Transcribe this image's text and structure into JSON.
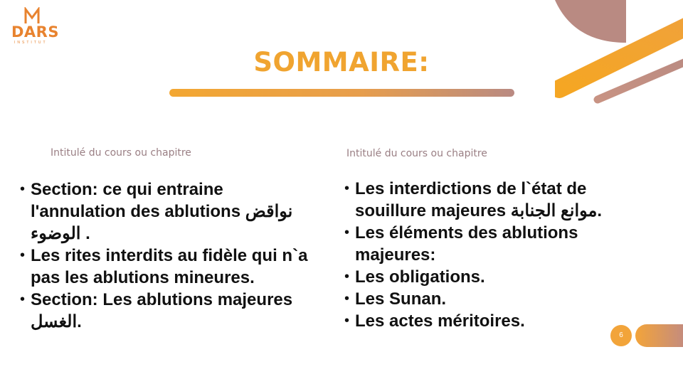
{
  "logo": {
    "name": "DARS",
    "subtitle": "INSTITUT"
  },
  "title": "SOMMAIRE:",
  "left_column": {
    "heading": "Intitulé du cours ou chapitre",
    "items": [
      "Section: ce qui entraine l'annulation des ablutions نواقض الوضوء .",
      "Les rites interdits au fidèle qui n`a pas les ablutions mineures.",
      "Section: Les ablutions majeures الغسل."
    ]
  },
  "right_column": {
    "heading": "Intitulé du cours ou chapitre",
    "items": [
      "Les interdictions de l`état de souillure majeures موانع الجنابة.",
      "Les éléments des ablutions majeures:",
      "Les obligations.",
      "Les Sunan.",
      "Les actes méritoires."
    ]
  },
  "page_number": "6",
  "colors": {
    "accent": "#f0a430",
    "accent_dark": "#e8832f",
    "mauve": "#b98a82"
  },
  "icons": [
    "dars-logo-icon"
  ]
}
